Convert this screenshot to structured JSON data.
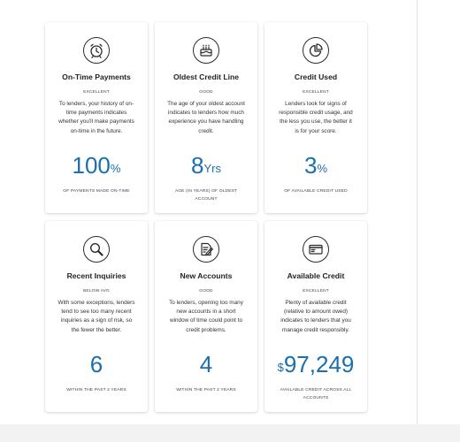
{
  "cards": [
    {
      "icon": "alarm-clock-icon",
      "title": "On-Time Payments",
      "rating": "EXCELLENT",
      "description": "To lenders, your history of on-time payments indicates whether you'll make payments on-time in the future.",
      "prefix": "",
      "value": "100",
      "unit": "%",
      "caption": "OF PAYMENTS MADE ON-TIME"
    },
    {
      "icon": "birthday-cake-icon",
      "title": "Oldest Credit Line",
      "rating": "GOOD",
      "description": "The age of your oldest account indicates to lenders how much experience you have handling credit.",
      "prefix": "",
      "value": "8",
      "unit": "Yrs",
      "caption": "AGE (IN YEARS) OF OLDEST ACCOUNT"
    },
    {
      "icon": "pie-chart-icon",
      "title": "Credit Used",
      "rating": "EXCELLENT",
      "description": "Lenders look for signs of responsible credit usage, and the less you use, the better it is for your score.",
      "prefix": "",
      "value": "3",
      "unit": "%",
      "caption": "OF AVAILABLE CREDIT USED"
    },
    {
      "icon": "magnifying-glass-icon",
      "title": "Recent Inquiries",
      "rating": "BELOW AVG",
      "description": "With some exceptions, lenders tend to see too many recent inquiries as a sign of risk, so the fewer the better.",
      "prefix": "",
      "value": "6",
      "unit": "",
      "caption": "WITHIN THE PAST 2 YEARS"
    },
    {
      "icon": "document-pen-icon",
      "title": "New Accounts",
      "rating": "GOOD",
      "description": "To lenders, opening too many new accounts in a short window of time could point to credit problems.",
      "prefix": "",
      "value": "4",
      "unit": "",
      "caption": "WITHIN THE PAST 2 YEARS"
    },
    {
      "icon": "credit-card-icon",
      "title": "Available Credit",
      "rating": "EXCELLENT",
      "description": "Plenty of available credit (relative to amount owed) indicates to lenders that you manage credit responsibly.",
      "prefix": "$",
      "value": "97,249",
      "unit": "",
      "caption": "AVAILABLE CREDIT ACROSS ALL ACCOUNTS"
    }
  ]
}
